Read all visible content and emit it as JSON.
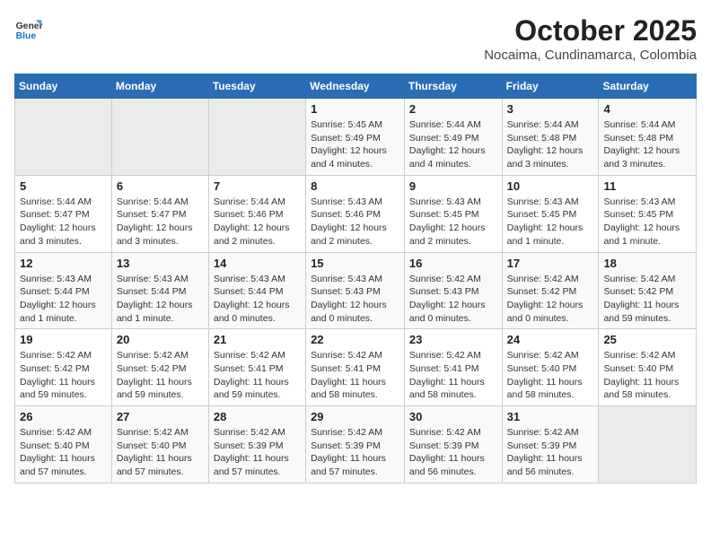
{
  "header": {
    "logo_line1": "General",
    "logo_line2": "Blue",
    "month": "October 2025",
    "location": "Nocaima, Cundinamarca, Colombia"
  },
  "weekdays": [
    "Sunday",
    "Monday",
    "Tuesday",
    "Wednesday",
    "Thursday",
    "Friday",
    "Saturday"
  ],
  "weeks": [
    [
      {
        "day": "",
        "sunrise": "",
        "sunset": "",
        "daylight": ""
      },
      {
        "day": "",
        "sunrise": "",
        "sunset": "",
        "daylight": ""
      },
      {
        "day": "",
        "sunrise": "",
        "sunset": "",
        "daylight": ""
      },
      {
        "day": "1",
        "sunrise": "Sunrise: 5:45 AM",
        "sunset": "Sunset: 5:49 PM",
        "daylight": "Daylight: 12 hours and 4 minutes."
      },
      {
        "day": "2",
        "sunrise": "Sunrise: 5:44 AM",
        "sunset": "Sunset: 5:49 PM",
        "daylight": "Daylight: 12 hours and 4 minutes."
      },
      {
        "day": "3",
        "sunrise": "Sunrise: 5:44 AM",
        "sunset": "Sunset: 5:48 PM",
        "daylight": "Daylight: 12 hours and 3 minutes."
      },
      {
        "day": "4",
        "sunrise": "Sunrise: 5:44 AM",
        "sunset": "Sunset: 5:48 PM",
        "daylight": "Daylight: 12 hours and 3 minutes."
      }
    ],
    [
      {
        "day": "5",
        "sunrise": "Sunrise: 5:44 AM",
        "sunset": "Sunset: 5:47 PM",
        "daylight": "Daylight: 12 hours and 3 minutes."
      },
      {
        "day": "6",
        "sunrise": "Sunrise: 5:44 AM",
        "sunset": "Sunset: 5:47 PM",
        "daylight": "Daylight: 12 hours and 3 minutes."
      },
      {
        "day": "7",
        "sunrise": "Sunrise: 5:44 AM",
        "sunset": "Sunset: 5:46 PM",
        "daylight": "Daylight: 12 hours and 2 minutes."
      },
      {
        "day": "8",
        "sunrise": "Sunrise: 5:43 AM",
        "sunset": "Sunset: 5:46 PM",
        "daylight": "Daylight: 12 hours and 2 minutes."
      },
      {
        "day": "9",
        "sunrise": "Sunrise: 5:43 AM",
        "sunset": "Sunset: 5:45 PM",
        "daylight": "Daylight: 12 hours and 2 minutes."
      },
      {
        "day": "10",
        "sunrise": "Sunrise: 5:43 AM",
        "sunset": "Sunset: 5:45 PM",
        "daylight": "Daylight: 12 hours and 1 minute."
      },
      {
        "day": "11",
        "sunrise": "Sunrise: 5:43 AM",
        "sunset": "Sunset: 5:45 PM",
        "daylight": "Daylight: 12 hours and 1 minute."
      }
    ],
    [
      {
        "day": "12",
        "sunrise": "Sunrise: 5:43 AM",
        "sunset": "Sunset: 5:44 PM",
        "daylight": "Daylight: 12 hours and 1 minute."
      },
      {
        "day": "13",
        "sunrise": "Sunrise: 5:43 AM",
        "sunset": "Sunset: 5:44 PM",
        "daylight": "Daylight: 12 hours and 1 minute."
      },
      {
        "day": "14",
        "sunrise": "Sunrise: 5:43 AM",
        "sunset": "Sunset: 5:44 PM",
        "daylight": "Daylight: 12 hours and 0 minutes."
      },
      {
        "day": "15",
        "sunrise": "Sunrise: 5:43 AM",
        "sunset": "Sunset: 5:43 PM",
        "daylight": "Daylight: 12 hours and 0 minutes."
      },
      {
        "day": "16",
        "sunrise": "Sunrise: 5:42 AM",
        "sunset": "Sunset: 5:43 PM",
        "daylight": "Daylight: 12 hours and 0 minutes."
      },
      {
        "day": "17",
        "sunrise": "Sunrise: 5:42 AM",
        "sunset": "Sunset: 5:42 PM",
        "daylight": "Daylight: 12 hours and 0 minutes."
      },
      {
        "day": "18",
        "sunrise": "Sunrise: 5:42 AM",
        "sunset": "Sunset: 5:42 PM",
        "daylight": "Daylight: 11 hours and 59 minutes."
      }
    ],
    [
      {
        "day": "19",
        "sunrise": "Sunrise: 5:42 AM",
        "sunset": "Sunset: 5:42 PM",
        "daylight": "Daylight: 11 hours and 59 minutes."
      },
      {
        "day": "20",
        "sunrise": "Sunrise: 5:42 AM",
        "sunset": "Sunset: 5:42 PM",
        "daylight": "Daylight: 11 hours and 59 minutes."
      },
      {
        "day": "21",
        "sunrise": "Sunrise: 5:42 AM",
        "sunset": "Sunset: 5:41 PM",
        "daylight": "Daylight: 11 hours and 59 minutes."
      },
      {
        "day": "22",
        "sunrise": "Sunrise: 5:42 AM",
        "sunset": "Sunset: 5:41 PM",
        "daylight": "Daylight: 11 hours and 58 minutes."
      },
      {
        "day": "23",
        "sunrise": "Sunrise: 5:42 AM",
        "sunset": "Sunset: 5:41 PM",
        "daylight": "Daylight: 11 hours and 58 minutes."
      },
      {
        "day": "24",
        "sunrise": "Sunrise: 5:42 AM",
        "sunset": "Sunset: 5:40 PM",
        "daylight": "Daylight: 11 hours and 58 minutes."
      },
      {
        "day": "25",
        "sunrise": "Sunrise: 5:42 AM",
        "sunset": "Sunset: 5:40 PM",
        "daylight": "Daylight: 11 hours and 58 minutes."
      }
    ],
    [
      {
        "day": "26",
        "sunrise": "Sunrise: 5:42 AM",
        "sunset": "Sunset: 5:40 PM",
        "daylight": "Daylight: 11 hours and 57 minutes."
      },
      {
        "day": "27",
        "sunrise": "Sunrise: 5:42 AM",
        "sunset": "Sunset: 5:40 PM",
        "daylight": "Daylight: 11 hours and 57 minutes."
      },
      {
        "day": "28",
        "sunrise": "Sunrise: 5:42 AM",
        "sunset": "Sunset: 5:39 PM",
        "daylight": "Daylight: 11 hours and 57 minutes."
      },
      {
        "day": "29",
        "sunrise": "Sunrise: 5:42 AM",
        "sunset": "Sunset: 5:39 PM",
        "daylight": "Daylight: 11 hours and 57 minutes."
      },
      {
        "day": "30",
        "sunrise": "Sunrise: 5:42 AM",
        "sunset": "Sunset: 5:39 PM",
        "daylight": "Daylight: 11 hours and 56 minutes."
      },
      {
        "day": "31",
        "sunrise": "Sunrise: 5:42 AM",
        "sunset": "Sunset: 5:39 PM",
        "daylight": "Daylight: 11 hours and 56 minutes."
      },
      {
        "day": "",
        "sunrise": "",
        "sunset": "",
        "daylight": ""
      }
    ]
  ]
}
